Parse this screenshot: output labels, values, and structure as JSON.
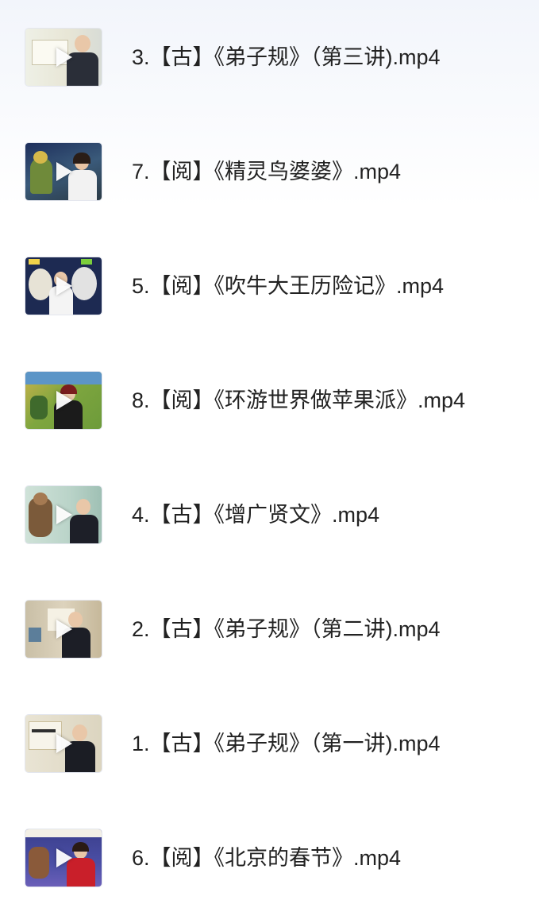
{
  "files": [
    {
      "name": "3.【古】《弟子规》（第三讲).mp4",
      "thumb_icon": "video-thumbnail",
      "accent": "#f3efe2"
    },
    {
      "name": "7.【阅】《精灵鸟婆婆》.mp4",
      "thumb_icon": "video-thumbnail",
      "accent": "#2c3f6c"
    },
    {
      "name": "5.【阅】《吹牛大王历险记》.mp4",
      "thumb_icon": "video-thumbnail",
      "accent": "#1f2d56"
    },
    {
      "name": "8.【阅】《环游世界做苹果派》.mp4",
      "thumb_icon": "video-thumbnail",
      "accent": "#8fb24c"
    },
    {
      "name": "4.【古】《增广贤文》.mp4",
      "thumb_icon": "video-thumbnail",
      "accent": "#b9d3c8"
    },
    {
      "name": "2.【古】《弟子规》（第二讲).mp4",
      "thumb_icon": "video-thumbnail",
      "accent": "#d8cdb5"
    },
    {
      "name": "1.【古】《弟子规》（第一讲).mp4",
      "thumb_icon": "video-thumbnail",
      "accent": "#e6e0cf"
    },
    {
      "name": "6.【阅】《北京的春节》.mp4",
      "thumb_icon": "video-thumbnail",
      "accent": "#3b3f8c"
    }
  ]
}
